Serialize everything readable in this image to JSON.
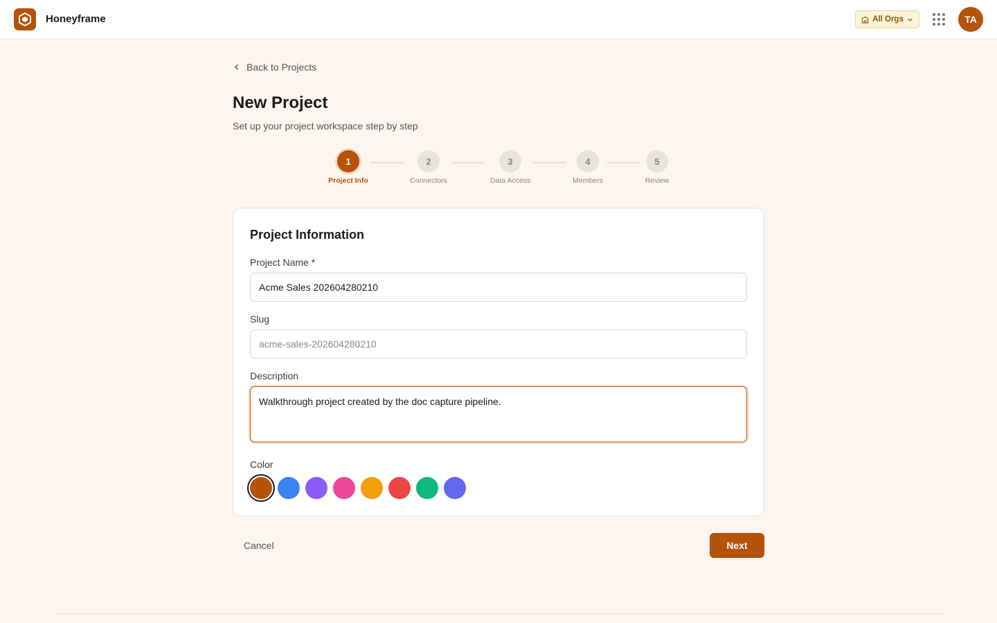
{
  "app": {
    "name": "Honeyframe",
    "brand_color": "#b5520b"
  },
  "header": {
    "org_switcher_label": "All Orgs",
    "avatar_initials": "TA"
  },
  "nav": {
    "back_label": "Back to Projects"
  },
  "page": {
    "title": "New Project",
    "subtitle": "Set up your project workspace step by step"
  },
  "stepper": {
    "steps": [
      {
        "number": "1",
        "label": "Project Info",
        "state": "active"
      },
      {
        "number": "2",
        "label": "Connectors",
        "state": "upcoming"
      },
      {
        "number": "3",
        "label": "Data Access",
        "state": "upcoming"
      },
      {
        "number": "4",
        "label": "Members",
        "state": "upcoming"
      },
      {
        "number": "5",
        "label": "Review",
        "state": "upcoming"
      }
    ]
  },
  "form": {
    "section_title": "Project Information",
    "project_name": {
      "label": "Project Name *",
      "value": "Acme Sales 202604280210"
    },
    "slug": {
      "label": "Slug",
      "value": "acme-sales-202604280210"
    },
    "description": {
      "label": "Description",
      "value": "Walkthrough project created by the doc capture pipeline."
    },
    "color": {
      "label": "Color",
      "selected_index": 0,
      "options": [
        "#b5520b",
        "#3b82f6",
        "#8b5cf6",
        "#ec4899",
        "#f59e0b",
        "#ef4444",
        "#10b981",
        "#6366f1"
      ]
    }
  },
  "actions": {
    "cancel_label": "Cancel",
    "next_label": "Next"
  }
}
